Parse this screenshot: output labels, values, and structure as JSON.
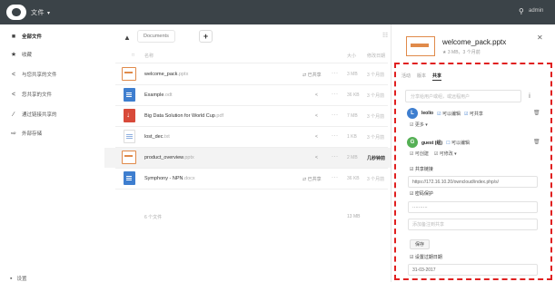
{
  "topbar": {
    "app_title": "文件",
    "user": "admin",
    "search_icon": "search-icon"
  },
  "sidebar": {
    "items": [
      {
        "label": "全部文件",
        "icon": "folder-icon",
        "active": true
      },
      {
        "label": "收藏",
        "icon": "star-icon"
      },
      {
        "label": "与您共享的文件",
        "icon": "share-icon"
      },
      {
        "label": "您共享的文件",
        "icon": "share-icon"
      },
      {
        "label": "通过链接共享的",
        "icon": "link-icon"
      },
      {
        "label": "外部存储",
        "icon": "external-icon"
      }
    ],
    "settings_label": "设置"
  },
  "files": {
    "breadcrumb": "Documents",
    "add_label": "+",
    "headers": {
      "name": "名称",
      "size": "大小",
      "modified": "修改日期"
    },
    "rows": [
      {
        "type": "ppt",
        "name": "welcome_pack",
        "ext": ".pptx",
        "share": "已共享",
        "size": "3 MB",
        "date": "3 个月前"
      },
      {
        "type": "doc",
        "name": "Example",
        "ext": ".odt",
        "share": "",
        "size": "36 KB",
        "date": "3 个月前"
      },
      {
        "type": "pdf",
        "name": "Big Data Solution for World Cup",
        "ext": ".pdf",
        "share": "",
        "size": "7 MB",
        "date": "3 个月前"
      },
      {
        "type": "txt",
        "name": "lost_dec",
        "ext": ".txt",
        "share": "",
        "size": "1 KB",
        "date": "3 个月前"
      },
      {
        "type": "ppt",
        "name": "product_overview",
        "ext": ".pptx",
        "share": "",
        "size": "2 MB",
        "date": "几秒钟前",
        "selected": true
      },
      {
        "type": "doc",
        "name": "Symphony - NPN",
        "ext": ".docx",
        "share": "已共享",
        "size": "36 KB",
        "date": "3 个月前"
      }
    ],
    "summary_left": "6 个文件",
    "summary_size": "13 MB"
  },
  "panel": {
    "title": "welcome_pack.pptx",
    "subtitle": "3 MB，3 个月前",
    "tabs": [
      "活动",
      "版本",
      "共享"
    ],
    "share_placeholder": "分享给用户或组，或远程用户",
    "sharees": [
      {
        "initial": "L",
        "color": "#3e7ecf",
        "name": "leolio",
        "perm_edit": "可以编辑",
        "perm_share": "可共享",
        "perm_more": "更多"
      },
      {
        "initial": "G",
        "color": "#55b055",
        "name": "guest (组)",
        "perm_edit": "可以编辑",
        "perm_create": "可创建",
        "perm_change": "可修改"
      }
    ],
    "link_share_label": "共享链接",
    "link_url": "https://172.16.10.20/owncloud/index.php/s/",
    "password_label": "密码保护",
    "password_value": "··········",
    "note_placeholder": "添加备注到共享",
    "save_label": "保存",
    "expiry_label": "设置过期日期",
    "expiry_value": "31-03-2017"
  }
}
